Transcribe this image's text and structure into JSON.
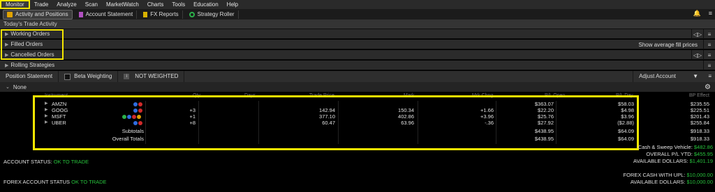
{
  "menu": [
    "Monitor",
    "Trade",
    "Analyze",
    "Scan",
    "MarketWatch",
    "Charts",
    "Tools",
    "Education",
    "Help"
  ],
  "subtabs": [
    {
      "label": "Activity and Positions",
      "icon": "folder-icon"
    },
    {
      "label": "Account Statement",
      "icon": "document-icon"
    },
    {
      "label": "FX Reports",
      "icon": "fx-report-icon"
    },
    {
      "label": "Strategy Roller",
      "icon": "roller-icon"
    }
  ],
  "activity_title": "Today's Trade Activity",
  "sections": {
    "working": "Working Orders",
    "filled": "Filled Orders",
    "cancelled": "Cancelled Orders",
    "rolling": "Rolling Strategies",
    "show_avg": "Show average fill prices"
  },
  "position_bar": {
    "title": "Position Statement",
    "beta": "Beta Weighting",
    "not_weighted": "NOT WEIGHTED",
    "adjust": "Adjust Account",
    "group": "None"
  },
  "columns": {
    "instrument": "Instrument",
    "qty": "Qty",
    "days": "Days",
    "trade_price": "Trade Price",
    "mark": "Mark",
    "mark_chg": "Mrk Chng",
    "pl_open": "P/L Open",
    "pl_day": "P/L Day",
    "bp_effect": "BP Effect"
  },
  "positions": [
    {
      "symbol": "AMZN",
      "qty": "",
      "trade_price": "",
      "mark": "",
      "mark_chg": "",
      "pl_open": "$363.07",
      "pl_day": "$58.03",
      "bp": "$235.55"
    },
    {
      "symbol": "GOOG",
      "qty": "+3",
      "trade_price": "142.94",
      "mark": "150.34",
      "mark_chg": "+1.66",
      "pl_open": "$22.20",
      "pl_day": "$4.98",
      "bp": "$225.51"
    },
    {
      "symbol": "MSFT",
      "qty": "+1",
      "trade_price": "377.10",
      "mark": "402.86",
      "mark_chg": "+3.96",
      "pl_open": "$25.76",
      "pl_day": "$3.96",
      "bp": "$201.43"
    },
    {
      "symbol": "UBER",
      "qty": "+8",
      "trade_price": "60.47",
      "mark": "63.96",
      "mark_chg": "-.36",
      "pl_open": "$27.92",
      "pl_day": "($2.88)",
      "bp": "$255.84"
    }
  ],
  "subtotals": {
    "label": "Subtotals",
    "pl_open": "$438.95",
    "pl_day": "$64.09",
    "bp": "$918.33"
  },
  "overall": {
    "label": "Overall Totals",
    "pl_open": "$438.95",
    "pl_day": "$64.09",
    "bp": "$918.33"
  },
  "account": {
    "status_label": "ACCOUNT STATUS:",
    "status_value": "OK TO TRADE",
    "forex_label": "FOREX ACCOUNT STATUS",
    "forex_value": "OK TO TRADE",
    "cash_label": "Cash & Sweep Vehicle:",
    "cash_value": "$482.86",
    "overall_pl_label": "OVERALL P/L YTD:",
    "overall_pl_value": "$455.95",
    "avail_label": "AVAILABLE DOLLARS:",
    "avail_value": "$1,401.19",
    "fx_cash_label": "FOREX CASH WITH UPL:",
    "fx_cash_value": "$10,000.00",
    "fx_avail_label": "AVAILABLE DOLLARS:",
    "fx_avail_value": "$10,000.00"
  }
}
